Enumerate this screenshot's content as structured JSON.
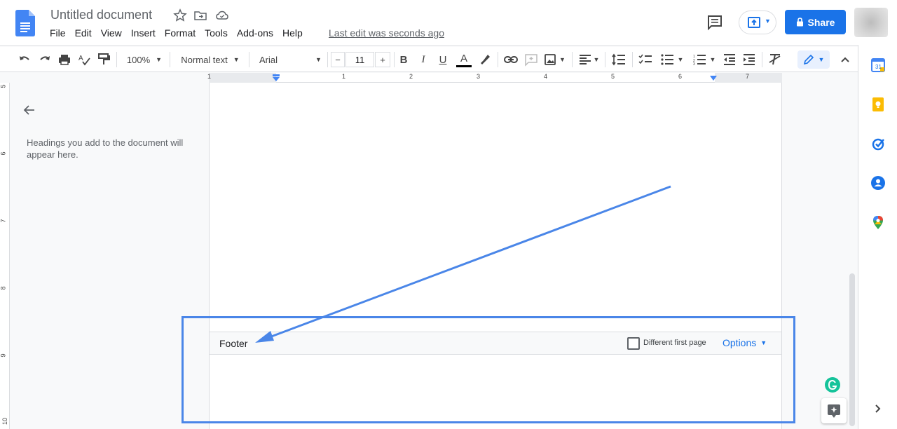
{
  "titlebar": {
    "doc_title": "Untitled document",
    "last_edit": "Last edit was seconds ago",
    "share_label": "Share"
  },
  "menu": [
    "File",
    "Edit",
    "View",
    "Insert",
    "Format",
    "Tools",
    "Add-ons",
    "Help"
  ],
  "toolbar": {
    "zoom": "100%",
    "style": "Normal text",
    "font": "Arial",
    "font_size": "11",
    "minus": "−",
    "plus": "+",
    "bold": "B",
    "italic": "I",
    "underline": "U",
    "text_color": "A"
  },
  "ruler": {
    "numbers": [
      "1",
      "1",
      "2",
      "3",
      "4",
      "5",
      "6",
      "7"
    ]
  },
  "vruler": {
    "numbers": [
      "5",
      "6",
      "7",
      "8",
      "9",
      "10"
    ]
  },
  "outline": {
    "placeholder": "Headings you add to the document will appear here."
  },
  "footer": {
    "label": "Footer",
    "different_first_page": "Different first page",
    "options": "Options"
  },
  "colors": {
    "accent": "#1a73e8",
    "annotation": "#4a86e8"
  }
}
